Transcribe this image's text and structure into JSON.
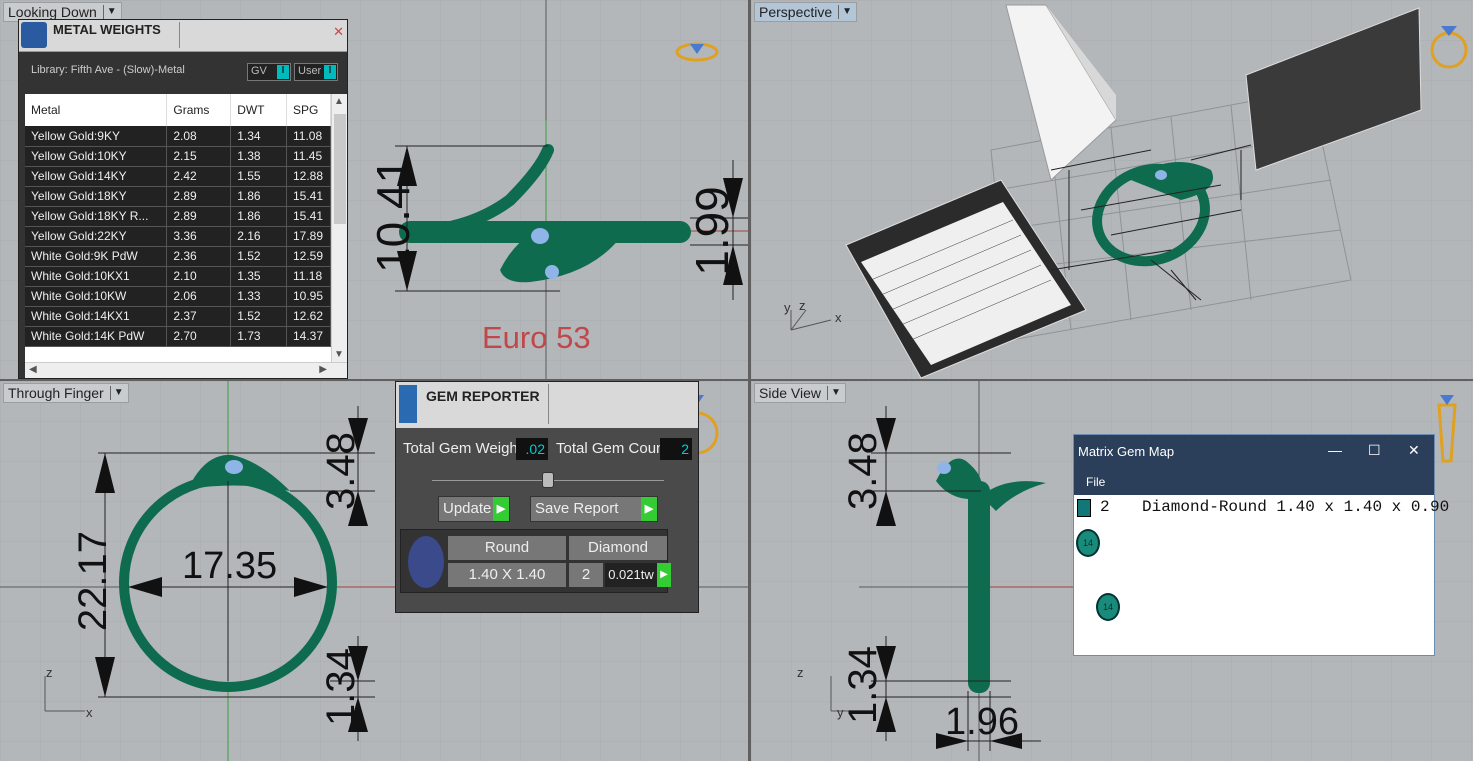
{
  "viewports": {
    "top_left": {
      "title": "Looking Down"
    },
    "top_right": {
      "title": "Perspective"
    },
    "bottom_left": {
      "title": "Through Finger"
    },
    "bottom_right": {
      "title": "Side View"
    }
  },
  "metal_weights": {
    "title": "METAL WEIGHTS",
    "library": "Library: Fifth Ave - (Slow)-Metal",
    "toggle_gv": "GV",
    "toggle_user": "User",
    "columns": [
      "Metal",
      "Grams",
      "DWT",
      "SPG"
    ],
    "rows": [
      [
        "Yellow Gold:9KY",
        "2.08",
        "1.34",
        "11.08"
      ],
      [
        "Yellow Gold:10KY",
        "2.15",
        "1.38",
        "11.45"
      ],
      [
        "Yellow Gold:14KY",
        "2.42",
        "1.55",
        "12.88"
      ],
      [
        "Yellow Gold:18KY",
        "2.89",
        "1.86",
        "15.41"
      ],
      [
        "Yellow Gold:18KY R...",
        "2.89",
        "1.86",
        "15.41"
      ],
      [
        "Yellow Gold:22KY",
        "3.36",
        "2.16",
        "17.89"
      ],
      [
        "White Gold:9K PdW",
        "2.36",
        "1.52",
        "12.59"
      ],
      [
        "White Gold:10KX1",
        "2.10",
        "1.35",
        "11.18"
      ],
      [
        "White Gold:10KW",
        "2.06",
        "1.33",
        "10.95"
      ],
      [
        "White Gold:14KX1",
        "2.37",
        "1.52",
        "12.62"
      ],
      [
        "White Gold:14K PdW",
        "2.70",
        "1.73",
        "14.37"
      ]
    ]
  },
  "looking_down": {
    "dim_height": "10.41",
    "dim_width": "1.99",
    "ring_size": "Euro 53"
  },
  "through_finger": {
    "dim_top": "3.48",
    "dim_height": "22.17",
    "dim_inner": "17.35",
    "dim_bottom": "1.34",
    "axis_z": "z",
    "axis_x": "x"
  },
  "side_view": {
    "dim_top": "3.48",
    "dim_bottom": "1.34",
    "dim_width": "1.96",
    "axis_z": "z",
    "axis_y": "y"
  },
  "perspective": {
    "axis_y": "y",
    "axis_z": "z",
    "axis_x": "x"
  },
  "gem_reporter": {
    "title": "GEM REPORTER",
    "total_weight_label": "Total Gem Weight",
    "total_weight_value": ".02",
    "total_count_label": "Total Gem Count",
    "total_count_value": "2",
    "update_label": "Update",
    "save_report_label": "Save Report",
    "table": {
      "col1": "Round",
      "col2": "Diamond",
      "size": "1.40 X 1.40",
      "count": "2",
      "weight": "0.021tw"
    }
  },
  "matrix_gem_map": {
    "title": "Matrix Gem Map",
    "menu_file": "File",
    "row_count": "2",
    "row_desc": "Diamond-Round 1.40 x 1.40 x 0.90",
    "disc1": "14",
    "disc2": "14"
  },
  "colors": {
    "ring": "#0f6b4d",
    "viewport_bg": "#b3b7ba",
    "ring_size_text": "#c0474a",
    "gem": "#8fb4e8"
  }
}
